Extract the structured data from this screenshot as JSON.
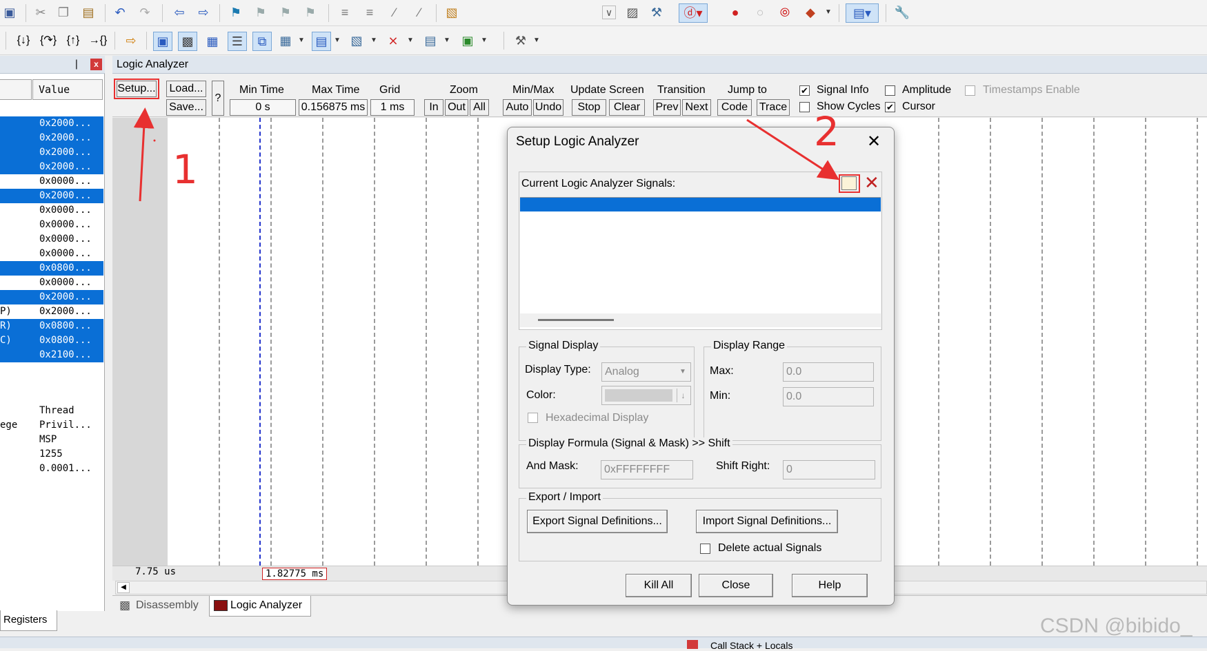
{
  "left_panel": {
    "pin_glyph": "❘",
    "close_glyph": "x",
    "column_value": "Value",
    "rows": [
      {
        "name": "",
        "value": "0x2000...",
        "selected": true
      },
      {
        "name": "",
        "value": "0x2000...",
        "selected": true
      },
      {
        "name": "",
        "value": "0x2000...",
        "selected": true
      },
      {
        "name": "",
        "value": "0x2000...",
        "selected": true
      },
      {
        "name": "",
        "value": "0x0000...",
        "selected": false
      },
      {
        "name": "",
        "value": "0x2000...",
        "selected": true
      },
      {
        "name": "",
        "value": "0x0000...",
        "selected": false
      },
      {
        "name": "",
        "value": "0x0000...",
        "selected": false
      },
      {
        "name": "",
        "value": "0x0000...",
        "selected": false
      },
      {
        "name": "",
        "value": "0x0000...",
        "selected": false
      },
      {
        "name": "",
        "value": "0x0800...",
        "selected": true
      },
      {
        "name": "",
        "value": "0x0000...",
        "selected": false
      },
      {
        "name": "",
        "value": "0x2000...",
        "selected": true
      },
      {
        "name": "P)",
        "value": "0x2000...",
        "selected": false
      },
      {
        "name": "R)",
        "value": "0x0800...",
        "selected": true
      },
      {
        "name": "C)",
        "value": "0x0800...",
        "selected": true
      },
      {
        "name": "",
        "value": "0x2100...",
        "selected": true
      }
    ],
    "info_rows": [
      {
        "name": "",
        "value": "Thread"
      },
      {
        "name": "ege",
        "value": "Privil..."
      },
      {
        "name": "",
        "value": "MSP"
      },
      {
        "name": "",
        "value": "1255"
      },
      {
        "name": "",
        "value": "0.0001..."
      }
    ],
    "registers_tab": "Registers"
  },
  "analyzer": {
    "title": "Logic Analyzer",
    "setup_button": "Setup...",
    "load_button": "Load...",
    "save_button": "Save...",
    "help_button": "?",
    "min_time_label": "Min Time",
    "min_time_value": "0 s",
    "max_time_label": "Max Time",
    "max_time_value": "0.156875 ms",
    "grid_label": "Grid",
    "grid_value": "1 ms",
    "zoom_label": "Zoom",
    "zoom_in": "In",
    "zoom_out": "Out",
    "zoom_all": "All",
    "minmax_label": "Min/Max",
    "minmax_auto": "Auto",
    "minmax_undo": "Undo",
    "update_label": "Update Screen",
    "update_stop": "Stop",
    "update_clear": "Clear",
    "transition_label": "Transition",
    "transition_prev": "Prev",
    "transition_next": "Next",
    "jump_label": "Jump to",
    "jump_code": "Code",
    "jump_trace": "Trace",
    "signal_info": "Signal Info",
    "signal_info_checked": true,
    "show_cycles": "Show Cycles",
    "show_cycles_checked": false,
    "amplitude": "Amplitude",
    "amplitude_checked": false,
    "cursor": "Cursor",
    "cursor_checked": true,
    "timestamps": "Timestamps Enable",
    "timestamps_checked": false,
    "time_left": "7.75 us",
    "time_cursor": "1.82775 ms",
    "tab_disassembly": "Disassembly",
    "tab_logic": "Logic Analyzer",
    "bottom_title": "Call Stack + Locals"
  },
  "dialog": {
    "title": "Setup Logic Analyzer",
    "close_glyph": "✕",
    "signals_label": "Current Logic Analyzer Signals:",
    "signal_display_group": "Signal Display",
    "display_type_label": "Display Type:",
    "display_type_value": "Analog",
    "color_label": "Color:",
    "hex_display": "Hexadecimal Display",
    "display_range_group": "Display Range",
    "max_label": "Max:",
    "max_value": "0.0",
    "min_label": "Min:",
    "min_value": "0.0",
    "formula_group": "Display Formula (Signal & Mask) >> Shift",
    "and_mask_label": "And Mask:",
    "and_mask_value": "0xFFFFFFFF",
    "shift_right_label": "Shift Right:",
    "shift_right_value": "0",
    "export_import_group": "Export / Import",
    "export_button": "Export Signal Definitions...",
    "import_button": "Import Signal Definitions...",
    "delete_signals": "Delete actual Signals",
    "kill_all_button": "Kill All",
    "close_button": "Close",
    "help_button": "Help"
  },
  "annotations": {
    "step1": "1",
    "step2": "2",
    "watermark": "CSDN @bibido_"
  },
  "colors": {
    "selection": "#0a6fd6",
    "annotation": "#e83030",
    "cursor_line": "#2233cc"
  }
}
